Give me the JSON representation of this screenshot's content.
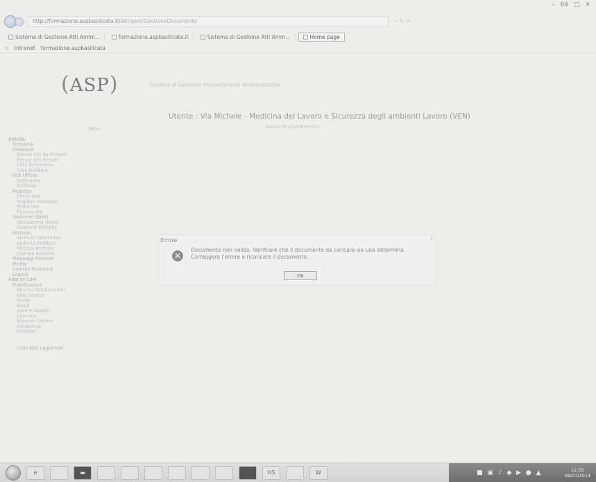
{
  "browser": {
    "address": "http://formazione.aspbasilicata.it/",
    "address_rest": "atti/gest/GestioneDocumento",
    "tabs": [
      {
        "label": "Sistema di Gestione Atti Ammi..."
      },
      {
        "label": "formazione.aspbasilicata.it"
      },
      {
        "label": "Sistema di Gestione Atti Amm..."
      },
      {
        "label": "Home page"
      }
    ],
    "favorites": [
      "Intranet",
      "formazione.aspbasilicata"
    ],
    "zoom_hint": "64"
  },
  "header": {
    "logo": "ASP",
    "system_name": "Sistema di Gestione Provvedimenti Amministrativi",
    "user_line": "Utente : Via Michele - Medicina del Lavoro e Sicurezza degli ambienti Lavoro (VEN)",
    "subline": "Nuovo Provvedimento"
  },
  "sidebar": {
    "title": "Menu",
    "items": [
      {
        "label": "Attività",
        "level": 0
      },
      {
        "label": "Scrivania",
        "level": 1
      },
      {
        "label": "Direzione",
        "level": 1
      },
      {
        "label": "Elenco Atti da Firmare",
        "level": 2
      },
      {
        "label": "Elenco Atti Firmati",
        "level": 2
      },
      {
        "label": "Crea Determina",
        "level": 2
      },
      {
        "label": "Crea Delibera",
        "level": 2
      },
      {
        "label": "Sub Ufficio",
        "level": 1
      },
      {
        "label": "Determine",
        "level": 2
      },
      {
        "label": "Delibere",
        "level": 2
      },
      {
        "label": "Registro",
        "level": 1
      },
      {
        "label": "Cerca Atto",
        "level": 2
      },
      {
        "label": "Registro Generale",
        "level": 2
      },
      {
        "label": "Protocollo",
        "level": 2
      },
      {
        "label": "Ricerca Atti",
        "level": 2
      },
      {
        "label": "Gestione Utenti",
        "level": 1
      },
      {
        "label": "Abilitazione Utenti",
        "level": 2
      },
      {
        "label": "Gestione Deleghe",
        "level": 2
      },
      {
        "label": "Archivio",
        "level": 1
      },
      {
        "label": "Archivio Determine",
        "level": 2
      },
      {
        "label": "Archivio Delibere",
        "level": 2
      },
      {
        "label": "Ricerca Archivio",
        "level": 2
      },
      {
        "label": "Stampa Registro",
        "level": 2
      },
      {
        "label": "Messaggi Ricevuti",
        "level": 1
      },
      {
        "label": "Profilo",
        "level": 1
      },
      {
        "label": "Cambia Password",
        "level": 1
      },
      {
        "label": "Logout",
        "level": 1
      },
      {
        "label": "Albo on Line",
        "level": 0
      },
      {
        "label": "Pubblicazioni",
        "level": 1
      },
      {
        "label": "Ricerca Pubblicazioni",
        "level": 2
      },
      {
        "label": "Albo Storico",
        "level": 2
      },
      {
        "label": "Avvisi",
        "level": 2
      },
      {
        "label": "Bandi",
        "level": 2
      },
      {
        "label": "Gare e Appalti",
        "level": 2
      },
      {
        "label": "Concorsi",
        "level": 2
      },
      {
        "label": "Manuale Utente",
        "level": 2
      },
      {
        "label": "Assistenza",
        "level": 2
      },
      {
        "label": "Contatti",
        "level": 2
      }
    ],
    "footer": "I tuoi dati aggiornati"
  },
  "dialog": {
    "title": "Errore",
    "close": "x",
    "message_line1": "Documento non valido. Verificare che il documento da caricare sia una determina.",
    "message_line2": "Correggere l'errore e ricaricare il documento.",
    "ok_label": "Ok"
  },
  "taskbar": {
    "buttons": [
      "",
      "",
      "",
      "",
      "",
      "",
      "",
      "",
      "",
      "",
      "HS",
      "",
      "W"
    ],
    "clock_time": "11:55",
    "clock_date": "08/07/2014"
  }
}
